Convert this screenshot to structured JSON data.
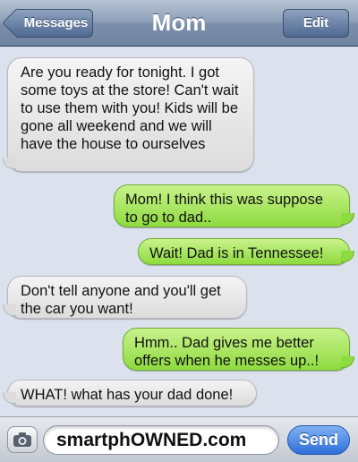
{
  "header": {
    "back_label": "Messages",
    "title": "Mom",
    "edit_label": "Edit"
  },
  "messages": [
    {
      "direction": "incoming",
      "text": "Are you ready for tonight. I got some toys at the store! Can't wait to use them with you! Kids will be gone all weekend and we will have the house to ourselves"
    },
    {
      "direction": "outgoing",
      "text": "Mom! I think this was suppose to go to dad.."
    },
    {
      "direction": "outgoing",
      "text": "Wait! Dad is in Tennessee!"
    },
    {
      "direction": "incoming",
      "text": "Don't tell anyone and you'll get the car you want!"
    },
    {
      "direction": "outgoing",
      "text": "Hmm.. Dad gives me better offers when he messes up..!"
    },
    {
      "direction": "incoming",
      "text": "WHAT! what has your dad done!"
    }
  ],
  "composer": {
    "input_value": "smartphOWNED.com",
    "send_label": "Send",
    "camera_icon": "camera-icon"
  },
  "colors": {
    "incoming_bubble": "#dcdcdc",
    "outgoing_bubble": "#8edb3f",
    "send_button": "#2f6ed8",
    "navbar": "#7c8fab"
  }
}
